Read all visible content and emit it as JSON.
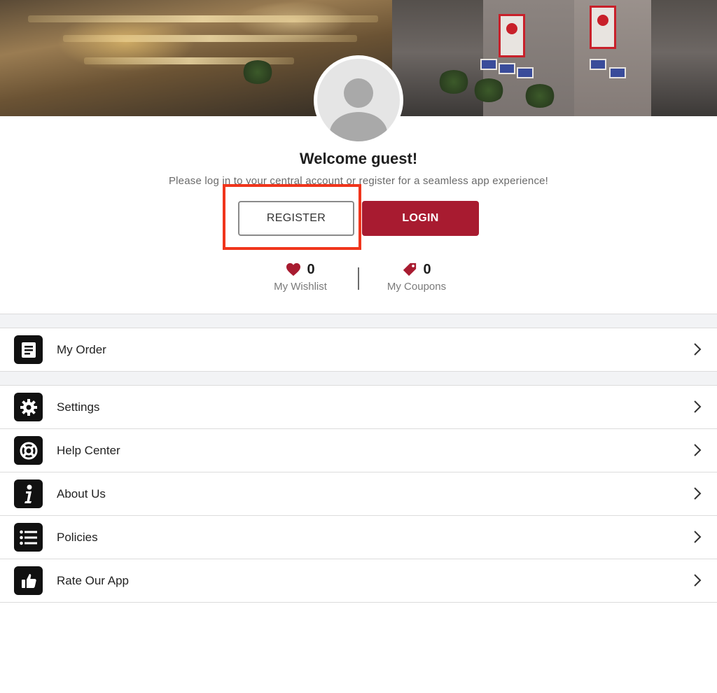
{
  "profile": {
    "welcome": "Welcome guest!",
    "subtitle": "Please log in to your central account or register for a seamless app experience!",
    "register_label": "REGISTER",
    "login_label": "LOGIN"
  },
  "stats": {
    "wishlist": {
      "count": "0",
      "label": "My Wishlist"
    },
    "coupons": {
      "count": "0",
      "label": "My Coupons"
    }
  },
  "menu": {
    "order": {
      "label": "My Order",
      "icon": "document-icon"
    },
    "items": [
      {
        "label": "Settings",
        "icon": "gear-icon"
      },
      {
        "label": "Help Center",
        "icon": "lifebuoy-icon"
      },
      {
        "label": "About Us",
        "icon": "info-icon"
      },
      {
        "label": "Policies",
        "icon": "list-icon"
      },
      {
        "label": "Rate Our App",
        "icon": "thumbs-up-icon"
      }
    ]
  },
  "colors": {
    "brand": "#a81b30",
    "highlight": "#f0351c",
    "band_bg": "#f2f3f5"
  }
}
